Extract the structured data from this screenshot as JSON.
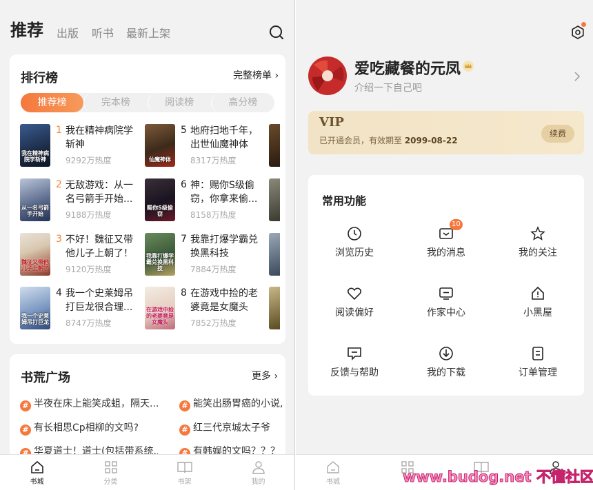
{
  "left": {
    "header": {
      "main_tab": "推荐",
      "tabs": [
        "出版",
        "听书",
        "最新上架"
      ]
    },
    "ranking": {
      "title": "排行榜",
      "more": "完整榜单",
      "tabs": [
        "推荐榜",
        "完本榜",
        "阅读榜",
        "高分榜"
      ],
      "books": [
        {
          "rank": "1",
          "title": "我在精神病院学斩神",
          "heat": "9292万热度",
          "cover_text": "我在精神病院学斩神"
        },
        {
          "rank": "2",
          "title": "无敌游戏：从一名弓箭手开始...",
          "heat": "9188万热度",
          "cover_text": "从一名弓箭手开始"
        },
        {
          "rank": "3",
          "title": "不好！魏征又带他儿子上朝了！",
          "heat": "9120万热度",
          "cover_text": "魏征又带他儿子上朝了"
        },
        {
          "rank": "4",
          "title": "我一个史莱姆吊打巨龙很合理...",
          "heat": "8747万热度",
          "cover_text": "我一个史莱姆吊打巨龙"
        },
        {
          "rank": "5",
          "title": "地府扫地千年，出世仙魔神体",
          "heat": "8317万热度",
          "cover_text": "仙魔神体"
        },
        {
          "rank": "6",
          "title": "神：赐你S级偷窃，你拿来偷...",
          "heat": "8158万热度",
          "cover_text": "赐你S级偷窃"
        },
        {
          "rank": "7",
          "title": "我靠打爆学霸兑换黑科技",
          "heat": "7884万热度",
          "cover_text": "我靠打爆学霸兑换黑科技"
        },
        {
          "rank": "8",
          "title": "在游戏中捡的老婆竟是女魔头",
          "heat": "7852万热度",
          "cover_text": "在游戏中捡的老婆竟是女魔头"
        }
      ]
    },
    "plaza": {
      "title": "书荒广场",
      "more": "更多",
      "hash": "#",
      "topics": [
        "半夜在床上能笑成蛆，隔天...",
        "能笑出肠胃癌的小说,",
        "有长相思Cp相柳的文吗?",
        "红三代京城太子爷",
        "华夏道士！道士(包括带系统...",
        "有韩娱的文吗？？？"
      ]
    },
    "nav": [
      {
        "label": "书城",
        "icon": "home-icon"
      },
      {
        "label": "分类",
        "icon": "grid-icon"
      },
      {
        "label": "书架",
        "icon": "book-icon"
      },
      {
        "label": "我的",
        "icon": "user-icon"
      }
    ]
  },
  "right": {
    "user": {
      "name": "爱吃藏餐的元凤",
      "intro": "介绍一下自己吧"
    },
    "vip": {
      "title": "VIP",
      "desc_prefix": "已开通会员，有效期至 ",
      "expire": "2099-08-22",
      "renew": "续费"
    },
    "functions": {
      "title": "常用功能",
      "items": [
        {
          "label": "浏览历史",
          "icon": "clock-icon"
        },
        {
          "label": "我的消息",
          "icon": "message-icon",
          "badge": "10"
        },
        {
          "label": "我的关注",
          "icon": "star-icon"
        },
        {
          "label": "阅读偏好",
          "icon": "heart-icon"
        },
        {
          "label": "作家中心",
          "icon": "monitor-icon"
        },
        {
          "label": "小黑屋",
          "icon": "house-alert-icon"
        },
        {
          "label": "反馈与帮助",
          "icon": "feedback-icon"
        },
        {
          "label": "我的下载",
          "icon": "download-icon"
        },
        {
          "label": "订单管理",
          "icon": "order-icon"
        }
      ]
    },
    "nav": [
      {
        "label": "书城"
      }
    ]
  },
  "watermark": "www.budog.net 不懂社区",
  "colors": {
    "accent": "#f5783d",
    "vip_text": "#6b5331",
    "vip_bg": "#f2e3c6"
  }
}
